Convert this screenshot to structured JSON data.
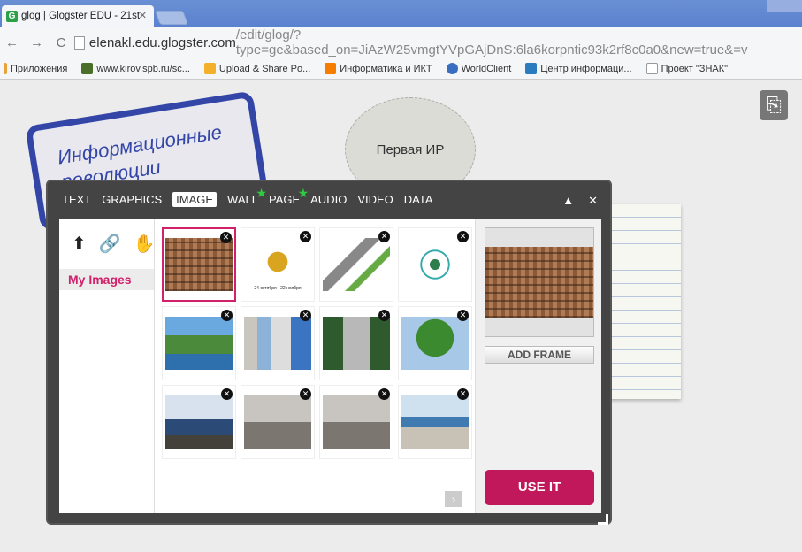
{
  "browser": {
    "tab_title": "glog | Glogster EDU - 21st",
    "tab_favicon": "G",
    "url_host": "elenakl.edu.glogster.com",
    "url_rest": "/edit/glog/?type=ge&based_on=JiAzW25vmgtYVpGAjDnS:6la6korpntic93k2rf8c0a0&new=true&=v",
    "bookmarks": [
      "Приложения",
      "www.kirov.spb.ru/sc...",
      "Upload & Share Po...",
      "Информатика и ИКТ",
      "WorldClient",
      "Центр информаци...",
      "Проект \"ЗНАК\""
    ]
  },
  "canvas": {
    "blue_note_text": "Информационные революции",
    "circle_text": "Первая ИР"
  },
  "dialog": {
    "menu": [
      "TEXT",
      "GRAPHICS",
      "IMAGE",
      "WALL",
      "PAGE",
      "AUDIO",
      "VIDEO",
      "DATA"
    ],
    "selected_menu": "IMAGE",
    "starred": [
      "WALL",
      "PAGE"
    ],
    "my_images_label": "My Images",
    "add_frame_label": "ADD FRAME",
    "use_it_label": "USE IT",
    "scorpion_caption": "24 октября - 22 ноября",
    "thumbnails": [
      "cuneiform",
      "scorpion",
      "microscope",
      "circle-diagram",
      "mountain",
      "board",
      "bridge",
      "tree",
      "lake",
      "fountain-1",
      "fountain-2",
      "house"
    ],
    "selected_thumbnail": "cuneiform"
  },
  "colors": {
    "accent": "#c0185a",
    "brand_blue": "#3346a8"
  }
}
